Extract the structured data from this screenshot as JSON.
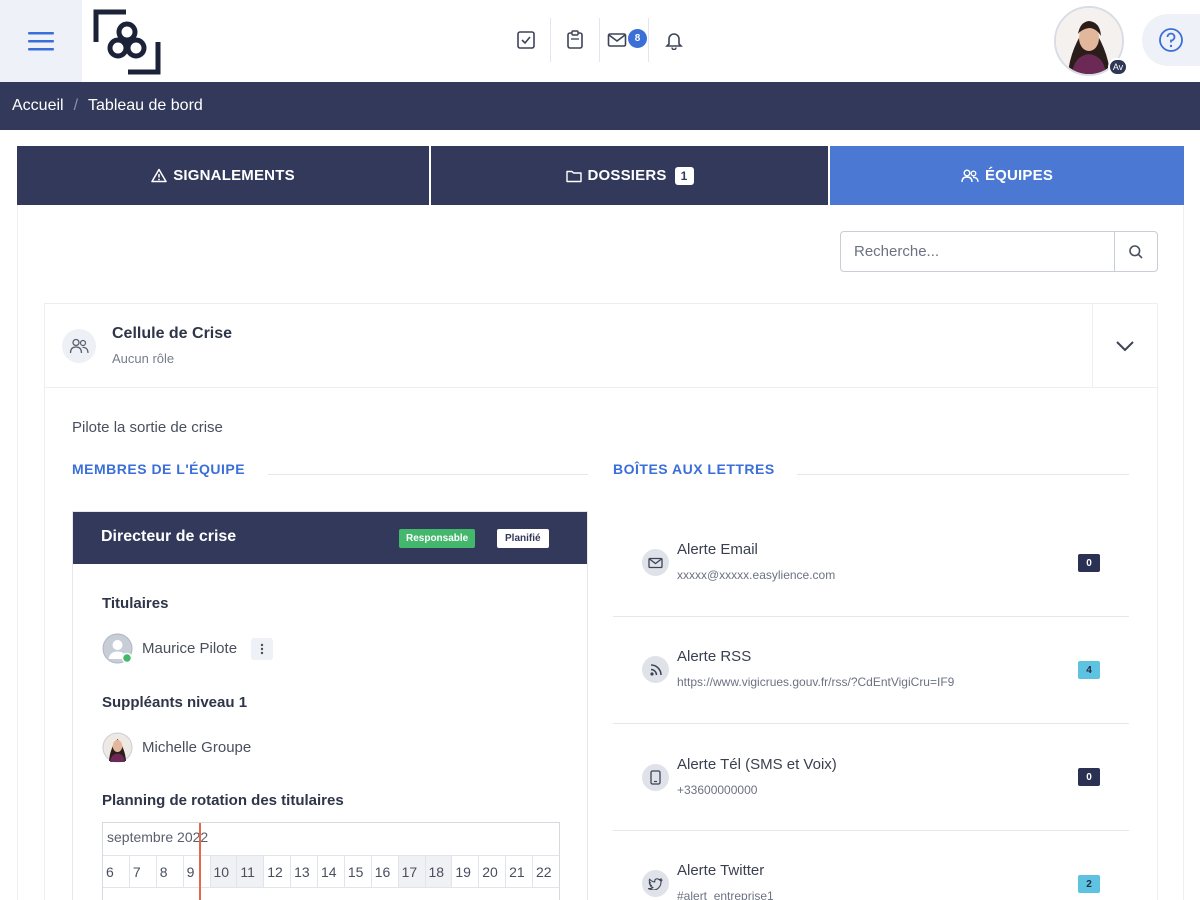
{
  "breadcrumb": {
    "home": "Accueil",
    "separator": "/",
    "current": "Tableau de bord"
  },
  "header": {
    "icons": [
      "check-square-icon",
      "clipboard-icon",
      "mail-icon",
      "bell-icon"
    ],
    "mail_count": "8",
    "avatar_tag": "Av"
  },
  "tabs": [
    {
      "label": "SIGNALEMENTS",
      "icon": "warning-icon",
      "badge": ""
    },
    {
      "label": "DOSSIERS",
      "icon": "folder-icon",
      "badge": "1"
    },
    {
      "label": "ÉQUIPES",
      "icon": "users-icon",
      "badge": ""
    }
  ],
  "search": {
    "placeholder": "Recherche..."
  },
  "team": {
    "name": "Cellule de Crise",
    "role": "Aucun rôle",
    "description": "Pilote la sortie de crise",
    "members_title": "MEMBRES DE L'ÉQUIPE",
    "mailboxes_title": "BOÎTES AUX LETTRES"
  },
  "role_card": {
    "title": "Directeur de crise",
    "badge_responsible": "Responsable",
    "badge_planned": "Planifié",
    "holders_title": "Titulaires",
    "holder_name": "Maurice Pilote",
    "deputies_title": "Suppléants niveau 1",
    "deputy_name": "Michelle Groupe",
    "rotation_title": "Planning de rotation des titulaires",
    "calendar_month": "septembre 2022",
    "calendar_days": [
      "6",
      "7",
      "8",
      "9",
      "10",
      "11",
      "12",
      "13",
      "14",
      "15",
      "16",
      "17",
      "18",
      "19",
      "20",
      "21",
      "22"
    ]
  },
  "mailboxes": [
    {
      "name": "Alerte Email",
      "address": "xxxxx@xxxxx.easylience.com",
      "count": "0",
      "style": "dark",
      "icon": "envelope-icon"
    },
    {
      "name": "Alerte RSS",
      "address": "https://www.vigicrues.gouv.fr/rss/?CdEntVigiCru=IF9",
      "count": "4",
      "style": "light",
      "icon": "rss-icon"
    },
    {
      "name": "Alerte Tél (SMS et Voix)",
      "address": "+33600000000",
      "count": "0",
      "style": "dark",
      "icon": "phone-icon"
    },
    {
      "name": "Alerte Twitter",
      "address": "#alert_entreprise1",
      "count": "2",
      "style": "light",
      "icon": "twitter-icon"
    }
  ],
  "colors": {
    "navy": "#32395a",
    "accent": "#4a78d2",
    "link": "#3b6fd8",
    "success": "#43b76b",
    "info": "#5ec3e0",
    "today_marker": "#e8664a"
  }
}
